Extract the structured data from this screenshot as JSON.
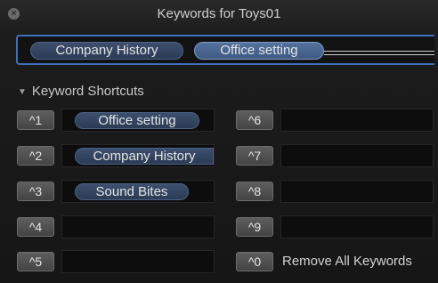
{
  "window": {
    "title": "Keywords for Toys01",
    "close_icon": "close-icon"
  },
  "keyword_field": {
    "tokens": [
      "Company History",
      "Office setting"
    ],
    "selected_token": "Office setting"
  },
  "shortcuts": {
    "header": "Keyword Shortcuts",
    "rows": [
      {
        "key": "^1",
        "keyword": "Office setting"
      },
      {
        "key": "^2",
        "keyword": "Company History"
      },
      {
        "key": "^3",
        "keyword": "Sound Bites"
      },
      {
        "key": "^4",
        "keyword": ""
      },
      {
        "key": "^5",
        "keyword": ""
      },
      {
        "key": "^6",
        "keyword": ""
      },
      {
        "key": "^7",
        "keyword": ""
      },
      {
        "key": "^8",
        "keyword": ""
      },
      {
        "key": "^9",
        "keyword": ""
      },
      {
        "key": "^0",
        "keyword": ""
      }
    ],
    "remove_all_label": "Remove All Keywords"
  },
  "colors": {
    "accent": "#3f6fb8",
    "token": "#3c4f6e",
    "token_selected": "#53729e",
    "background": "#1c1c1c"
  }
}
